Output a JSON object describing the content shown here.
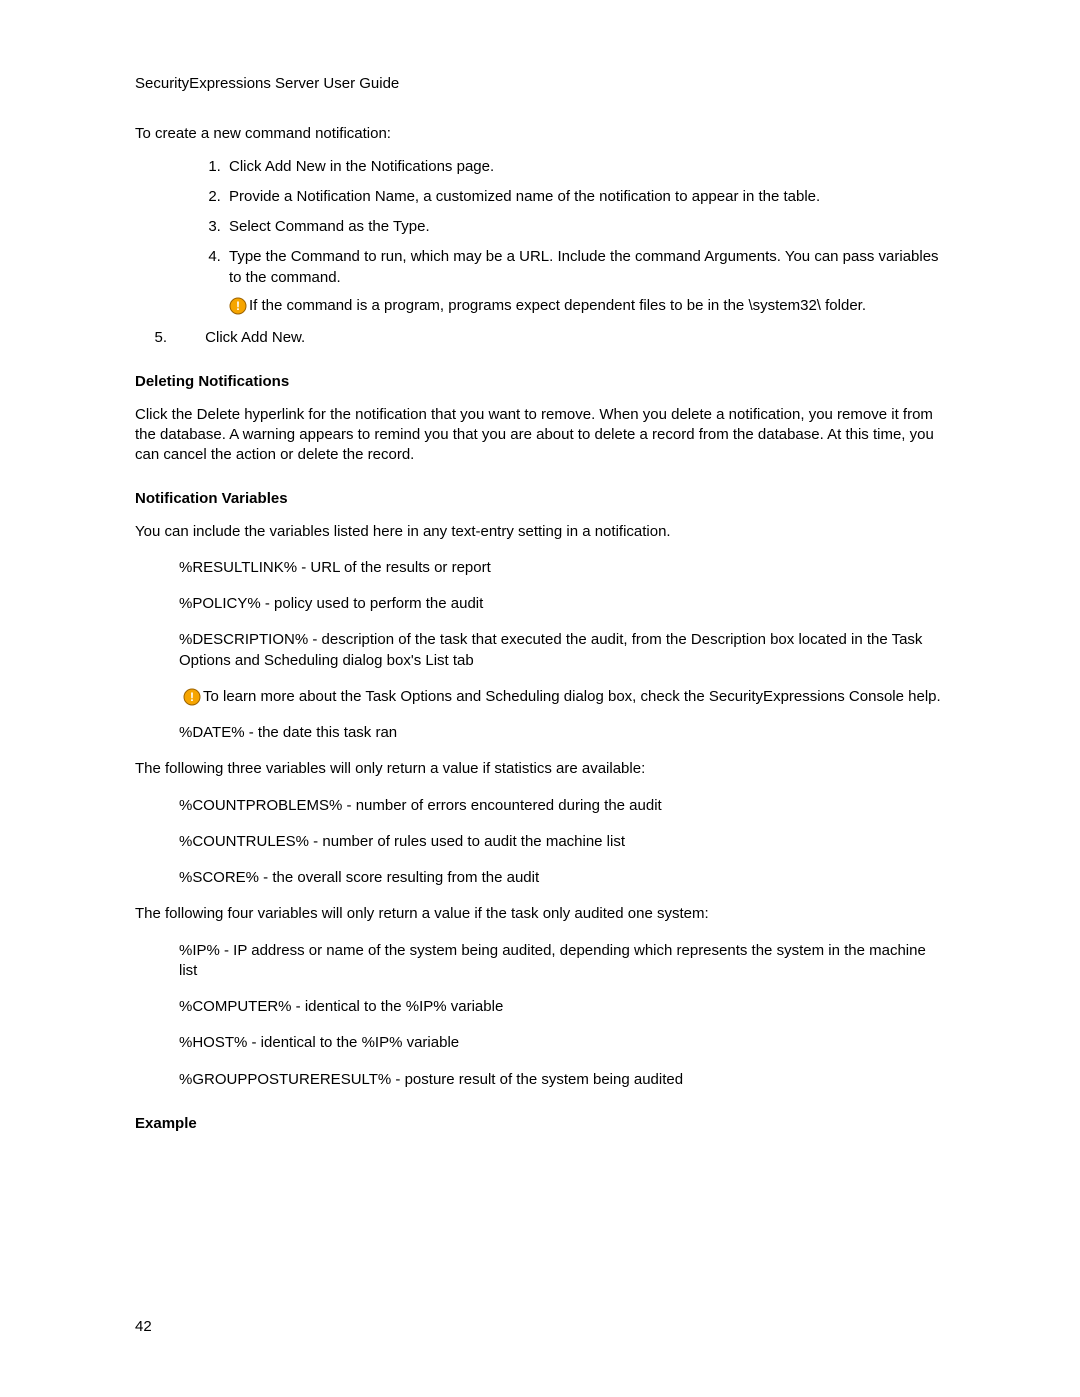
{
  "header": "SecurityExpressions Server User Guide",
  "intro": "To create a new command notification:",
  "steps": {
    "s1": "Click Add New in the Notifications page.",
    "s2": "Provide a Notification Name, a customized name of the notification to appear in the table.",
    "s3": "Select Command as the Type.",
    "s4": "Type the Command to run, which may be a URL. Include the command Arguments. You can pass variables to the command.",
    "note4": "If the command is a program, programs expect dependent files to be in the \\system32\\ folder.",
    "s5num": "5.",
    "s5text": "Click Add New."
  },
  "deleting": {
    "heading": "Deleting Notifications",
    "body": "Click the Delete hyperlink for the notification that you want to remove. When you delete a notification, you remove it from the database. A warning appears to remind you that you are about to delete a record from the database. At this time, you can cancel the action or delete the record."
  },
  "variables": {
    "heading": "Notification Variables",
    "intro": "You can include the variables listed here in any text-entry setting in a notification.",
    "v_resultlink": "%RESULTLINK% - URL of the results or report",
    "v_policy": "%POLICY% - policy used to perform the audit",
    "v_description": "%DESCRIPTION% - description of the task that executed the audit, from the Description box located in the Task Options and Scheduling dialog box's List tab",
    "note_task": "To learn more about the Task Options and Scheduling dialog box, check the SecurityExpressions Console help.",
    "v_date": "%DATE% - the date this task ran",
    "stats_intro": "The following three variables will only return a value if statistics are available:",
    "v_countproblems": "%COUNTPROBLEMS% - number of errors encountered during the audit",
    "v_countrules": "%COUNTRULES% - number of rules used to audit the machine list",
    "v_score": "%SCORE% - the overall score resulting from the audit",
    "single_intro": "The following four variables will only return a value if the task only audited one system:",
    "v_ip": "%IP% - IP address or name of the system being audited, depending which represents the system in the machine list",
    "v_computer": "%COMPUTER% - identical to the %IP% variable",
    "v_host": "%HOST% - identical to the %IP% variable",
    "v_groupposture": "%GROUPPOSTURERESULT% - posture result of the system being audited"
  },
  "example_heading": "Example",
  "page_number": "42"
}
